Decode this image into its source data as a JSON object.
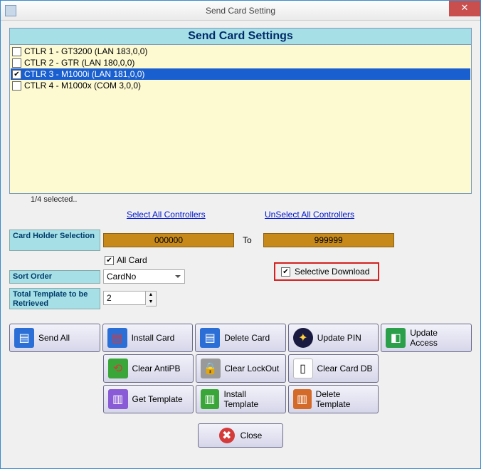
{
  "window": {
    "title": "Send Card Setting"
  },
  "panel_title": "Send Card Settings",
  "controllers": [
    {
      "label": "CTLR 1 - GT3200 (LAN 183,0,0)",
      "checked": false,
      "selected": false
    },
    {
      "label": "CTLR 2 - GTR (LAN 180,0,0)",
      "checked": false,
      "selected": false
    },
    {
      "label": "CTLR 3 - M1000i (LAN 181,0,0)",
      "checked": true,
      "selected": true
    },
    {
      "label": "CTLR 4 - M1000x (COM 3,0,0)",
      "checked": false,
      "selected": false
    }
  ],
  "selection_status": "1/4 selected..",
  "links": {
    "select_all": "Select All Controllers",
    "unselect_all": "UnSelect All Controllers"
  },
  "cardholder": {
    "label": "Card Holder Selection",
    "from": "000000",
    "to_label": "To",
    "to": "999999",
    "all_card_label": "All Card",
    "all_card_checked": true
  },
  "sort": {
    "label": "Sort Order",
    "value": "CardNo"
  },
  "template": {
    "label": "Total Template to be Retrieved",
    "value": "2"
  },
  "selective_dl": {
    "label": "Selective Download",
    "checked": true
  },
  "buttons": {
    "send_all": "Send All",
    "install_card": "Install Card",
    "delete_card": "Delete Card",
    "update_pin": "Update PIN",
    "update_access": "Update Access",
    "clear_antipb": "Clear AntiPB",
    "clear_lockout": "Clear LockOut",
    "clear_card_db": "Clear Card DB",
    "get_template": "Get Template",
    "install_template": "Install Template",
    "delete_template": "Delete Template",
    "close": "Close"
  },
  "icons": {
    "send_all": "#2b6fd6",
    "install_card": "#2b6fd6",
    "delete_card": "#2b6fd6",
    "update_pin": "#1a1a40",
    "update_access": "#2b9f4a",
    "clear_antipb": "#d43a3a",
    "clear_lockout": "#555",
    "clear_card_db": "#eee",
    "get_template": "#8a5bd6",
    "install_template": "#3aa63a",
    "delete_template": "#d46a2a",
    "close": "#d43a3a"
  }
}
